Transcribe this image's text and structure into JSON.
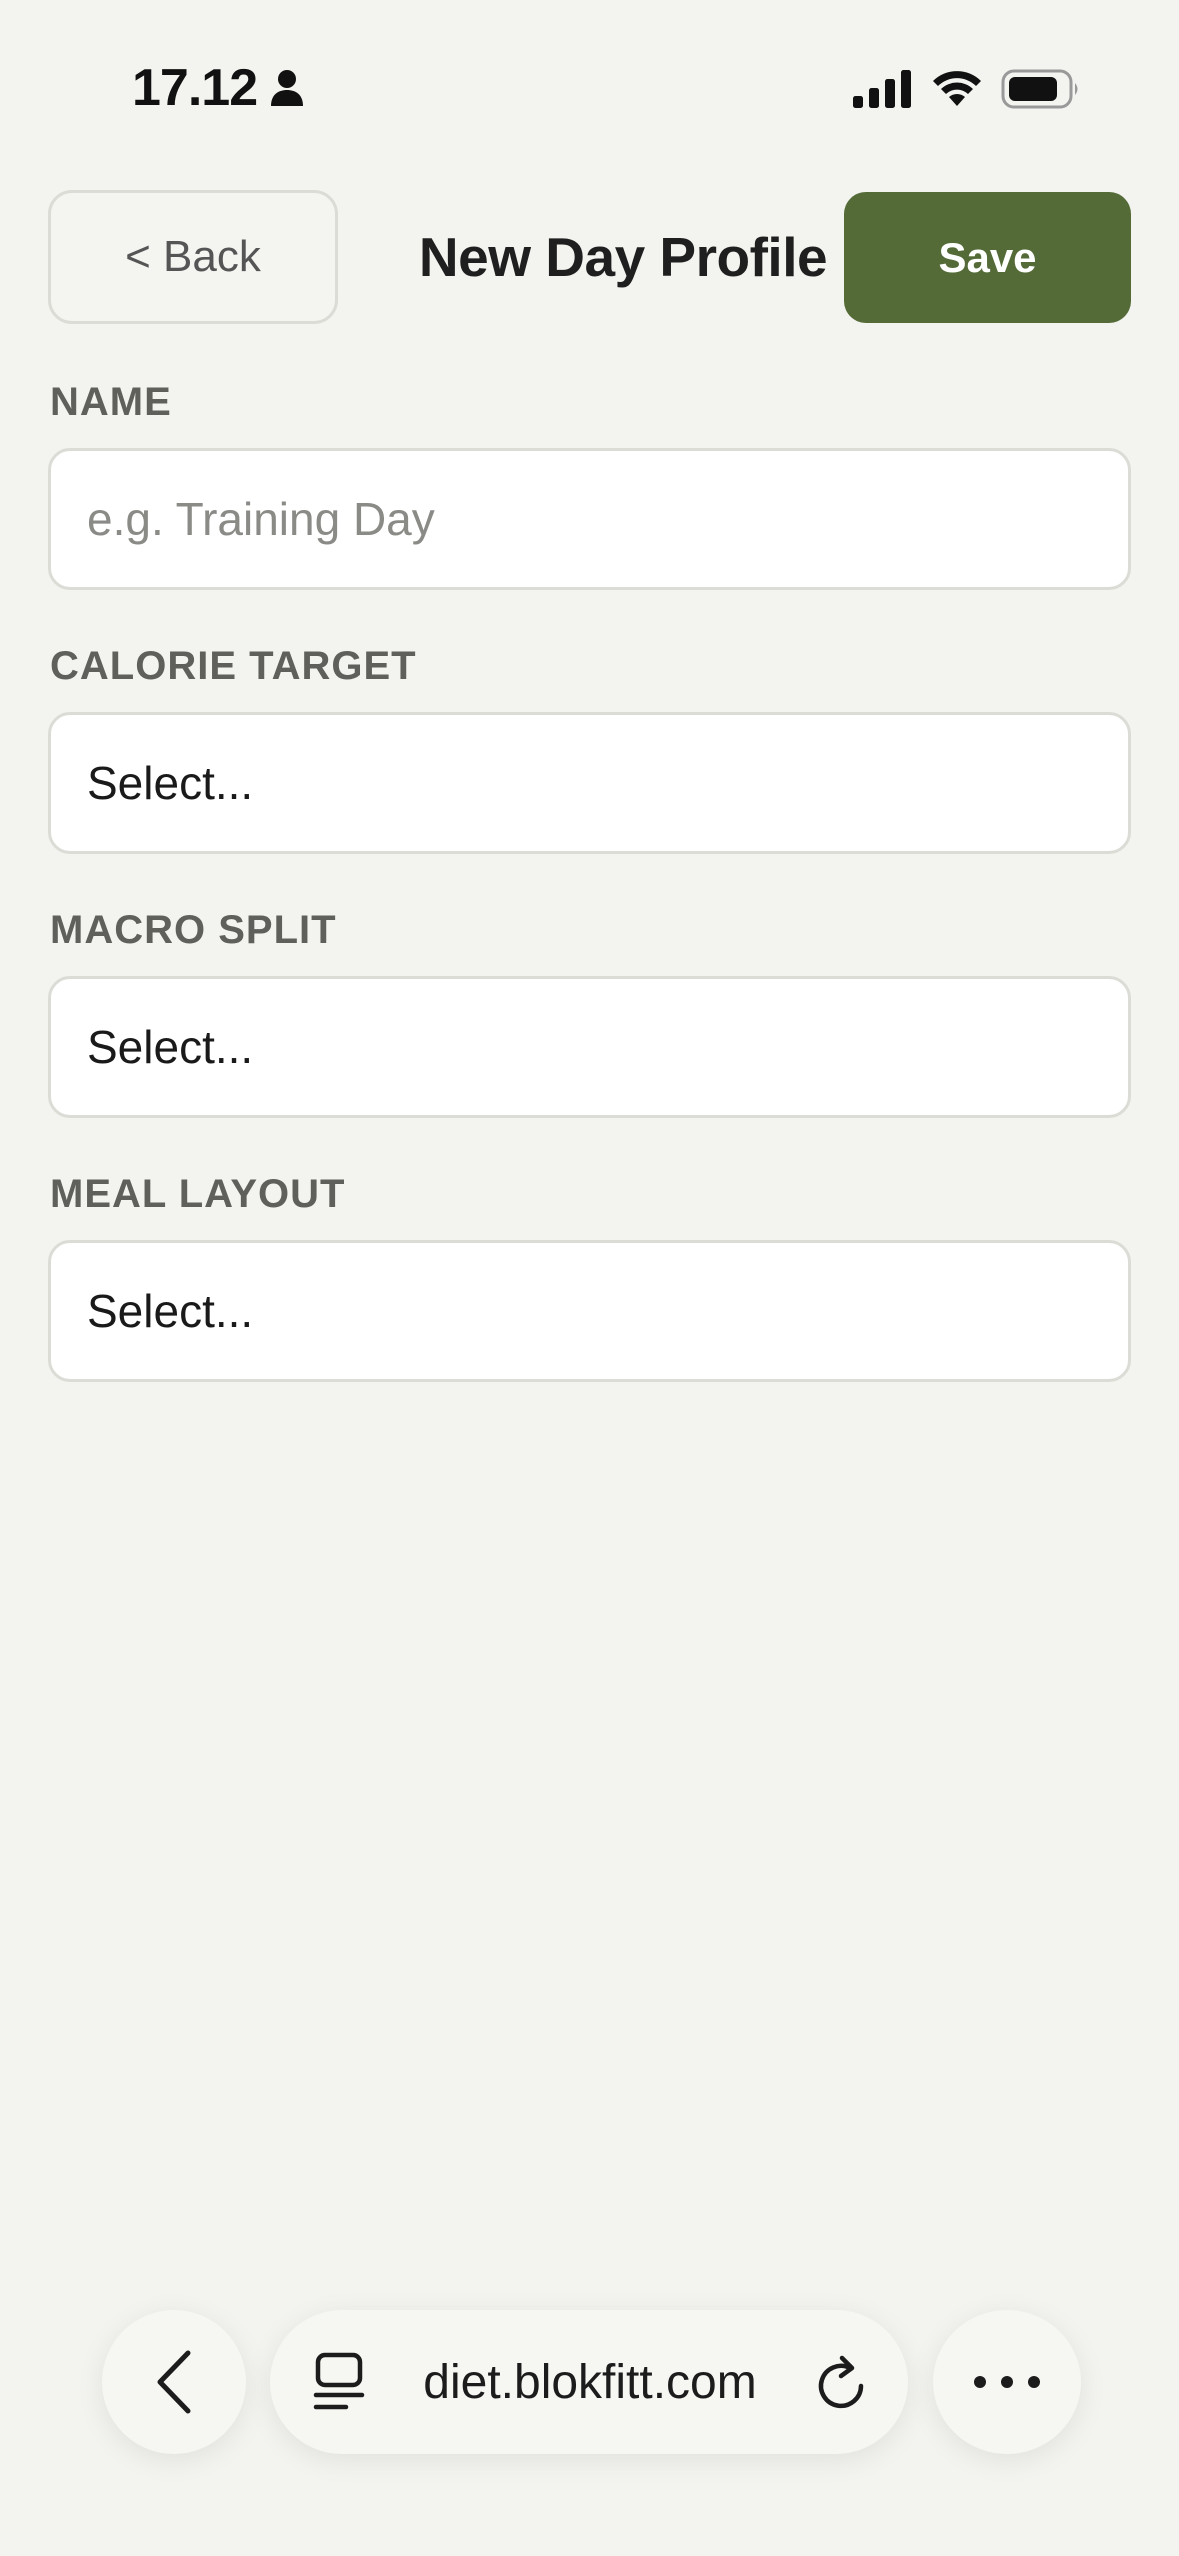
{
  "status_bar": {
    "time": "17.12",
    "icons": [
      "person-icon",
      "cellular-signal-icon",
      "wifi-icon",
      "battery-icon"
    ]
  },
  "header": {
    "back_label": "< Back",
    "title": "New Day Profile",
    "save_label": "Save"
  },
  "form": {
    "fields": [
      {
        "label": "NAME",
        "type": "text",
        "value": "",
        "placeholder": "e.g. Training Day"
      },
      {
        "label": "CALORIE TARGET",
        "type": "select",
        "value": "Select..."
      },
      {
        "label": "MACRO SPLIT",
        "type": "select",
        "value": "Select..."
      },
      {
        "label": "MEAL LAYOUT",
        "type": "select",
        "value": "Select..."
      }
    ]
  },
  "browser_bar": {
    "url": "diet.blokfitt.com",
    "icons": [
      "chevron-left-icon",
      "tabs-icon",
      "reload-icon",
      "more-icon"
    ]
  },
  "colors": {
    "background": "#f3f3ef",
    "accent": "#546a37",
    "label": "#5f5f5c",
    "border": "#dcdcd6"
  }
}
